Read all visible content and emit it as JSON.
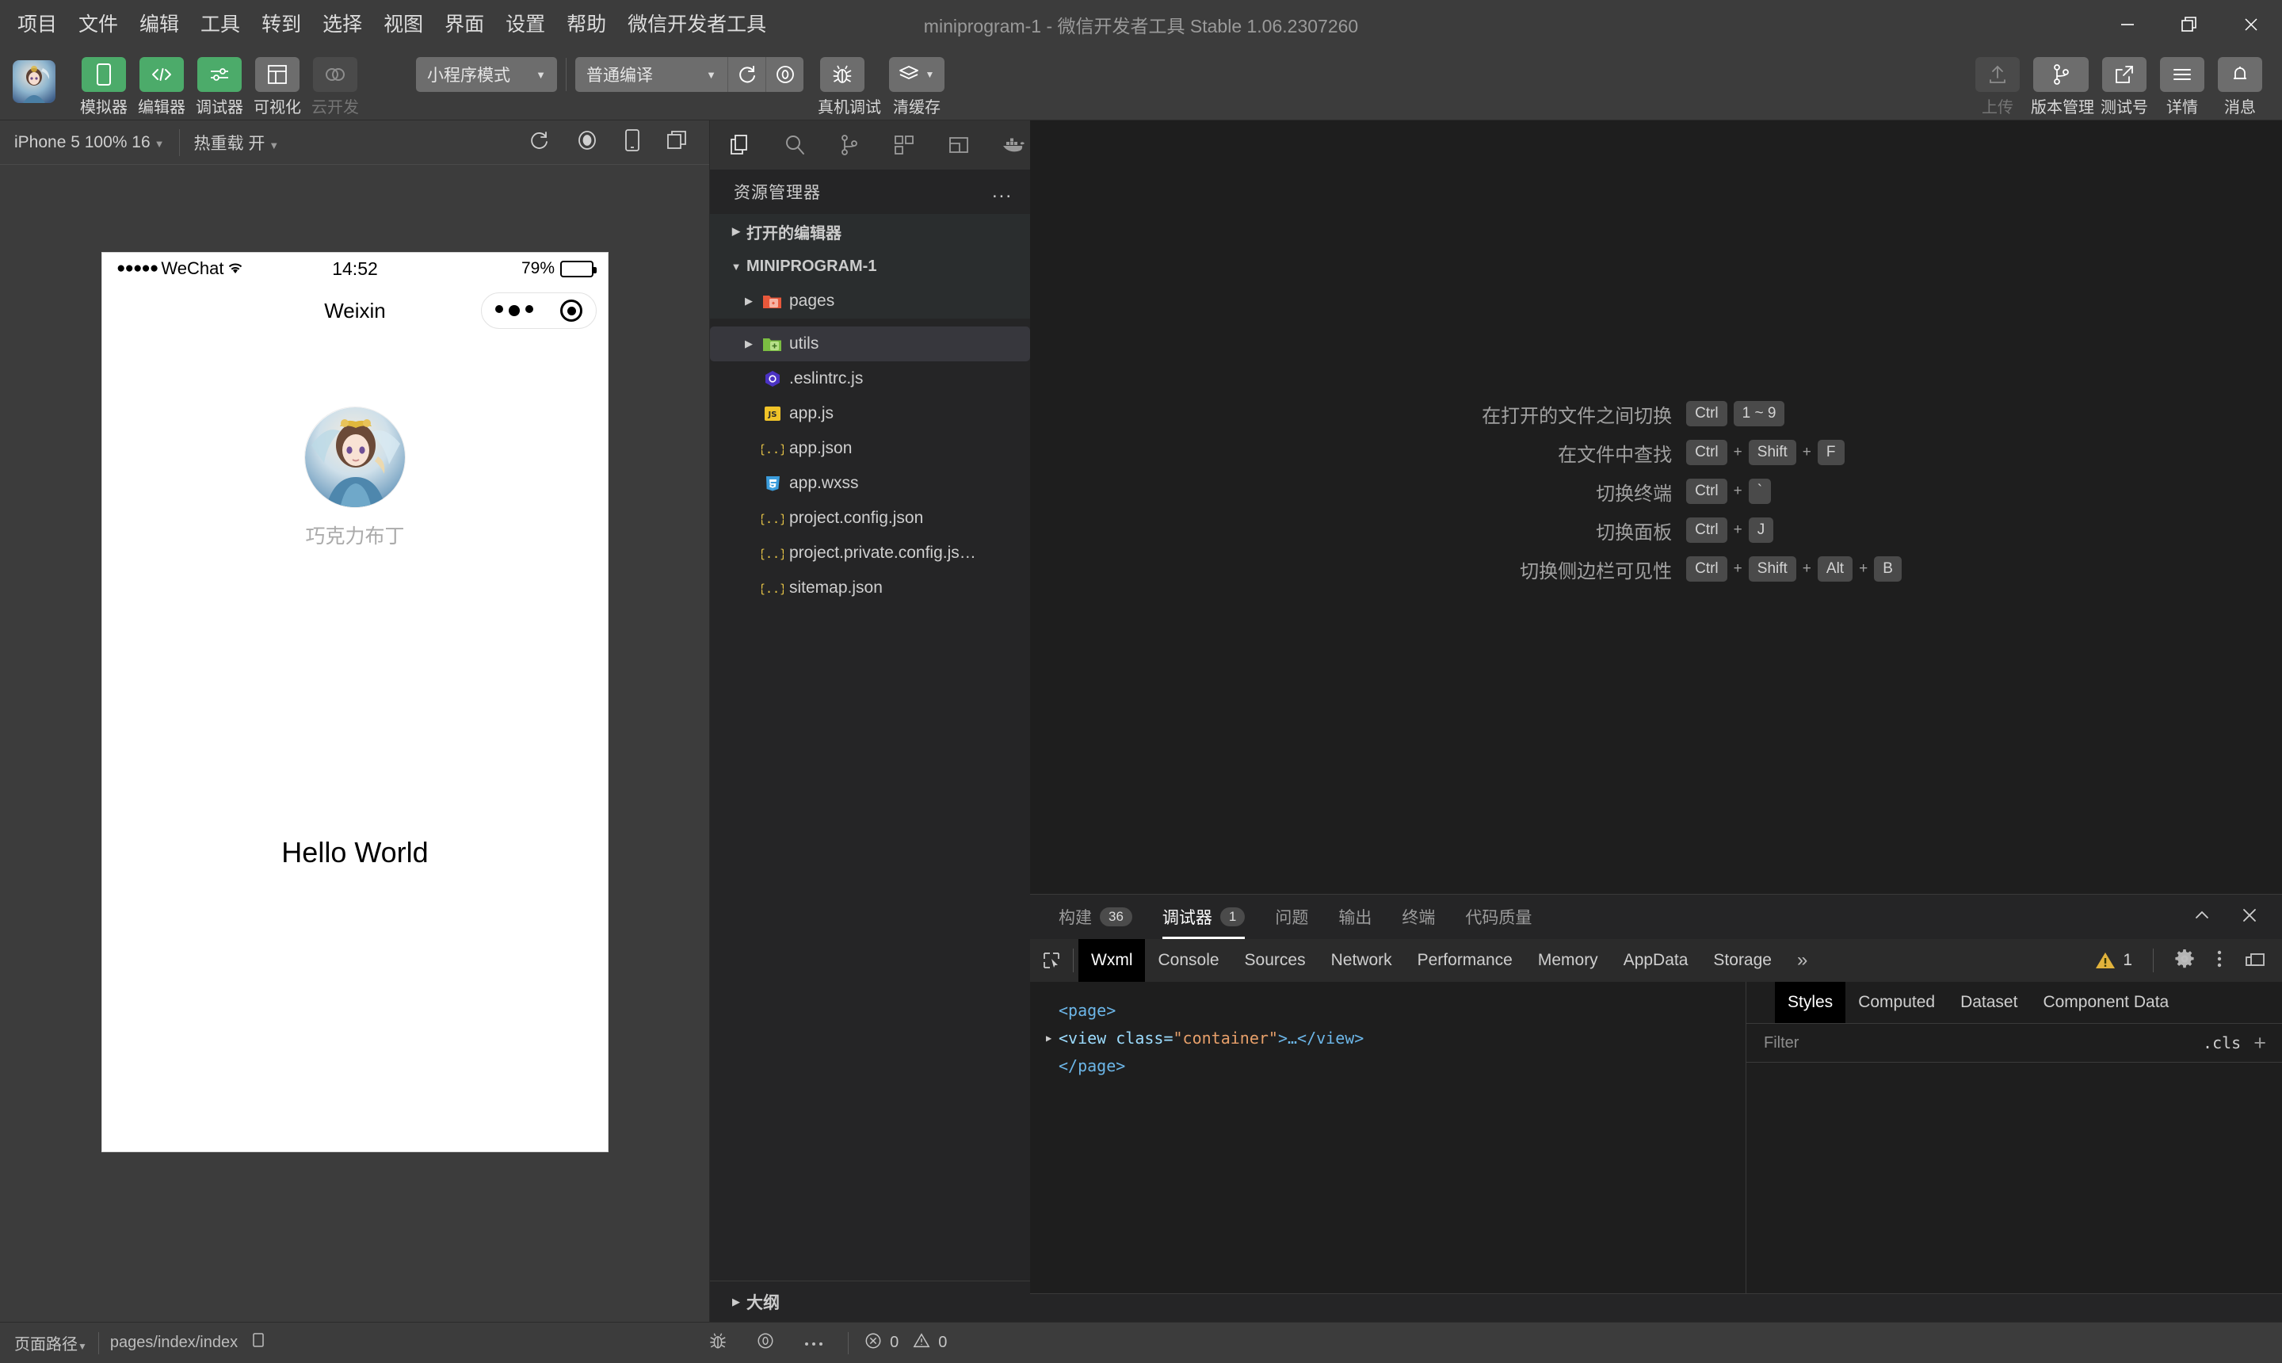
{
  "window": {
    "title": "miniprogram-1 - 微信开发者工具 Stable 1.06.2307260",
    "minimize_label": "minimize",
    "restore_label": "restore",
    "close_label": "close"
  },
  "menubar": {
    "items": [
      {
        "label": "项目"
      },
      {
        "label": "文件"
      },
      {
        "label": "编辑"
      },
      {
        "label": "工具"
      },
      {
        "label": "转到"
      },
      {
        "label": "选择"
      },
      {
        "label": "视图"
      },
      {
        "label": "界面"
      },
      {
        "label": "设置"
      },
      {
        "label": "帮助"
      },
      {
        "label": "微信开发者工具"
      }
    ]
  },
  "toolbar": {
    "left_buttons": [
      {
        "label": "模拟器",
        "icon": "phone-icon",
        "state": "active"
      },
      {
        "label": "编辑器",
        "icon": "code-icon",
        "state": "active"
      },
      {
        "label": "调试器",
        "icon": "sliders-icon",
        "state": "active"
      },
      {
        "label": "可视化",
        "icon": "layout-icon",
        "state": "inactive"
      },
      {
        "label": "云开发",
        "icon": "cloud-icon",
        "state": "disabled"
      }
    ],
    "mode_select": {
      "value": "小程序模式",
      "caret": "▼"
    },
    "compile_select": {
      "value": "普通编译",
      "caret": "▼"
    },
    "center_buttons": [
      {
        "label": "编译",
        "icon": "refresh-icon"
      },
      {
        "label": "预览",
        "icon": "preview-icon"
      },
      {
        "label": "真机调试",
        "icon": "bug-icon"
      },
      {
        "label": "清缓存",
        "icon": "layers-icon",
        "caret": "▼"
      }
    ],
    "right_buttons": [
      {
        "label": "上传",
        "icon": "upload-icon",
        "state": "disabled"
      },
      {
        "label": "版本管理",
        "icon": "git-branch-icon",
        "state": "enabled"
      },
      {
        "label": "测试号",
        "icon": "external-link-icon",
        "state": "enabled"
      },
      {
        "label": "详情",
        "icon": "menu-lines-icon",
        "state": "enabled"
      },
      {
        "label": "消息",
        "icon": "bell-icon",
        "state": "enabled"
      }
    ]
  },
  "simulator": {
    "device_select": "iPhone 5 100% 16",
    "device_caret": "▼",
    "hotreload_label": "热重载 开",
    "hotreload_caret": "▼",
    "icons": [
      "rotate-icon",
      "record-icon",
      "device-icon",
      "split-icon"
    ],
    "phone": {
      "status_carrier": "WeChat",
      "status_dots": "●●●●●",
      "status_time": "14:52",
      "status_battery_pct": "79%",
      "battery_level": 79,
      "nav_title": "Weixin",
      "capsule_more": "more-dots-icon",
      "capsule_target": "target-icon",
      "username": "巧克力布丁",
      "hello_text": "Hello World"
    }
  },
  "explorer": {
    "activity_icons": [
      "files-icon",
      "search-icon",
      "source-control-icon",
      "extensions-icon",
      "debug-panel-icon",
      "docker-icon"
    ],
    "title": "资源管理器",
    "more_label": "...",
    "sections": [
      {
        "label": "打开的编辑器",
        "twist": "▶",
        "type": "section"
      },
      {
        "label": "MINIPROGRAM-1",
        "twist": "▼",
        "type": "section"
      }
    ],
    "files": [
      {
        "name": "pages",
        "type": "folder",
        "twist": "▶",
        "color": "#e8583b",
        "state": "normal"
      },
      {
        "name": "utils",
        "type": "folder",
        "twist": "▶",
        "color": "#8cc152",
        "state": "selected"
      },
      {
        "name": ".eslintrc.js",
        "type": "eslint",
        "twist": "",
        "color": "#4b32c3",
        "state": "normal"
      },
      {
        "name": "app.js",
        "type": "js",
        "twist": "",
        "color": "#f5c518",
        "state": "normal"
      },
      {
        "name": "app.json",
        "type": "json",
        "twist": "",
        "color": "#e8c547",
        "state": "normal"
      },
      {
        "name": "app.wxss",
        "type": "css",
        "twist": "",
        "color": "#3b9ddd",
        "state": "normal"
      },
      {
        "name": "project.config.json",
        "type": "json",
        "twist": "",
        "color": "#e8c547",
        "state": "normal"
      },
      {
        "name": "project.private.config.js…",
        "type": "json",
        "twist": "",
        "color": "#e8c547",
        "state": "normal"
      },
      {
        "name": "sitemap.json",
        "type": "json",
        "twist": "",
        "color": "#e8c547",
        "state": "normal"
      }
    ],
    "outline_label": "大纲",
    "outline_twist": "▶"
  },
  "editor": {
    "shortcuts": [
      {
        "label": "在打开的文件之间切换",
        "keys": [
          "Ctrl",
          "1 ~ 9"
        ],
        "separators": [
          ""
        ]
      },
      {
        "label": "在文件中查找",
        "keys": [
          "Ctrl",
          "Shift",
          "F"
        ],
        "separators": [
          "+",
          "+"
        ]
      },
      {
        "label": "切换终端",
        "keys": [
          "Ctrl",
          "`"
        ],
        "separators": [
          "+"
        ]
      },
      {
        "label": "切换面板",
        "keys": [
          "Ctrl",
          "J"
        ],
        "separators": [
          "+"
        ]
      },
      {
        "label": "切换侧边栏可见性",
        "keys": [
          "Ctrl",
          "Shift",
          "Alt",
          "B"
        ],
        "separators": [
          "+",
          "+",
          "+"
        ]
      }
    ]
  },
  "debugger": {
    "tabs": [
      {
        "label": "构建",
        "badge": "36",
        "active": false
      },
      {
        "label": "调试器",
        "badge": "1",
        "active": true
      },
      {
        "label": "问题",
        "badge": "",
        "active": false
      },
      {
        "label": "输出",
        "badge": "",
        "active": false
      },
      {
        "label": "终端",
        "badge": "",
        "active": false
      },
      {
        "label": "代码质量",
        "badge": "",
        "active": false
      }
    ],
    "collapse_icon": "chevron-up-icon",
    "close_icon": "close-icon",
    "devtools_tabs": [
      {
        "label": "Wxml",
        "active": true
      },
      {
        "label": "Console",
        "active": false
      },
      {
        "label": "Sources",
        "active": false
      },
      {
        "label": "Network",
        "active": false
      },
      {
        "label": "Performance",
        "active": false
      },
      {
        "label": "Memory",
        "active": false
      },
      {
        "label": "AppData",
        "active": false
      },
      {
        "label": "Storage",
        "active": false
      }
    ],
    "overflow_label": "»",
    "warning_count": "1",
    "right_icons": [
      "gear-icon",
      "kebab-menu-icon",
      "dock-icon"
    ],
    "wxml": {
      "line1": "<page>",
      "line2_tag_open": "<view class=",
      "line2_value": "\"container\"",
      "line2_tag_close": ">…</view>",
      "line2_twist": "▶",
      "line3": "</page>"
    },
    "styles_panel": {
      "tabs": [
        {
          "label": "Styles",
          "active": true
        },
        {
          "label": "Computed",
          "active": false
        },
        {
          "label": "Dataset",
          "active": false
        },
        {
          "label": "Component Data",
          "active": false
        }
      ],
      "filter_placeholder": "Filter",
      "filter_value": "",
      "cls_label": ".cls",
      "add_label": "+"
    }
  },
  "statusbar": {
    "page_path_label": "页面路径",
    "page_path_caret": "▼",
    "page_path_value": "pages/index/index",
    "copy_icon": "copy-icon",
    "mid_icons": [
      "bug-icon",
      "preview-icon",
      "more-icon"
    ],
    "error_count": "0",
    "warning_count": "0"
  },
  "colors": {
    "accent_green": "#4cab6a",
    "panel_dark": "#252526",
    "editor_bg": "#1e1e1e",
    "chrome": "#3c3c3c",
    "warning_yellow": "#e2b33c"
  }
}
